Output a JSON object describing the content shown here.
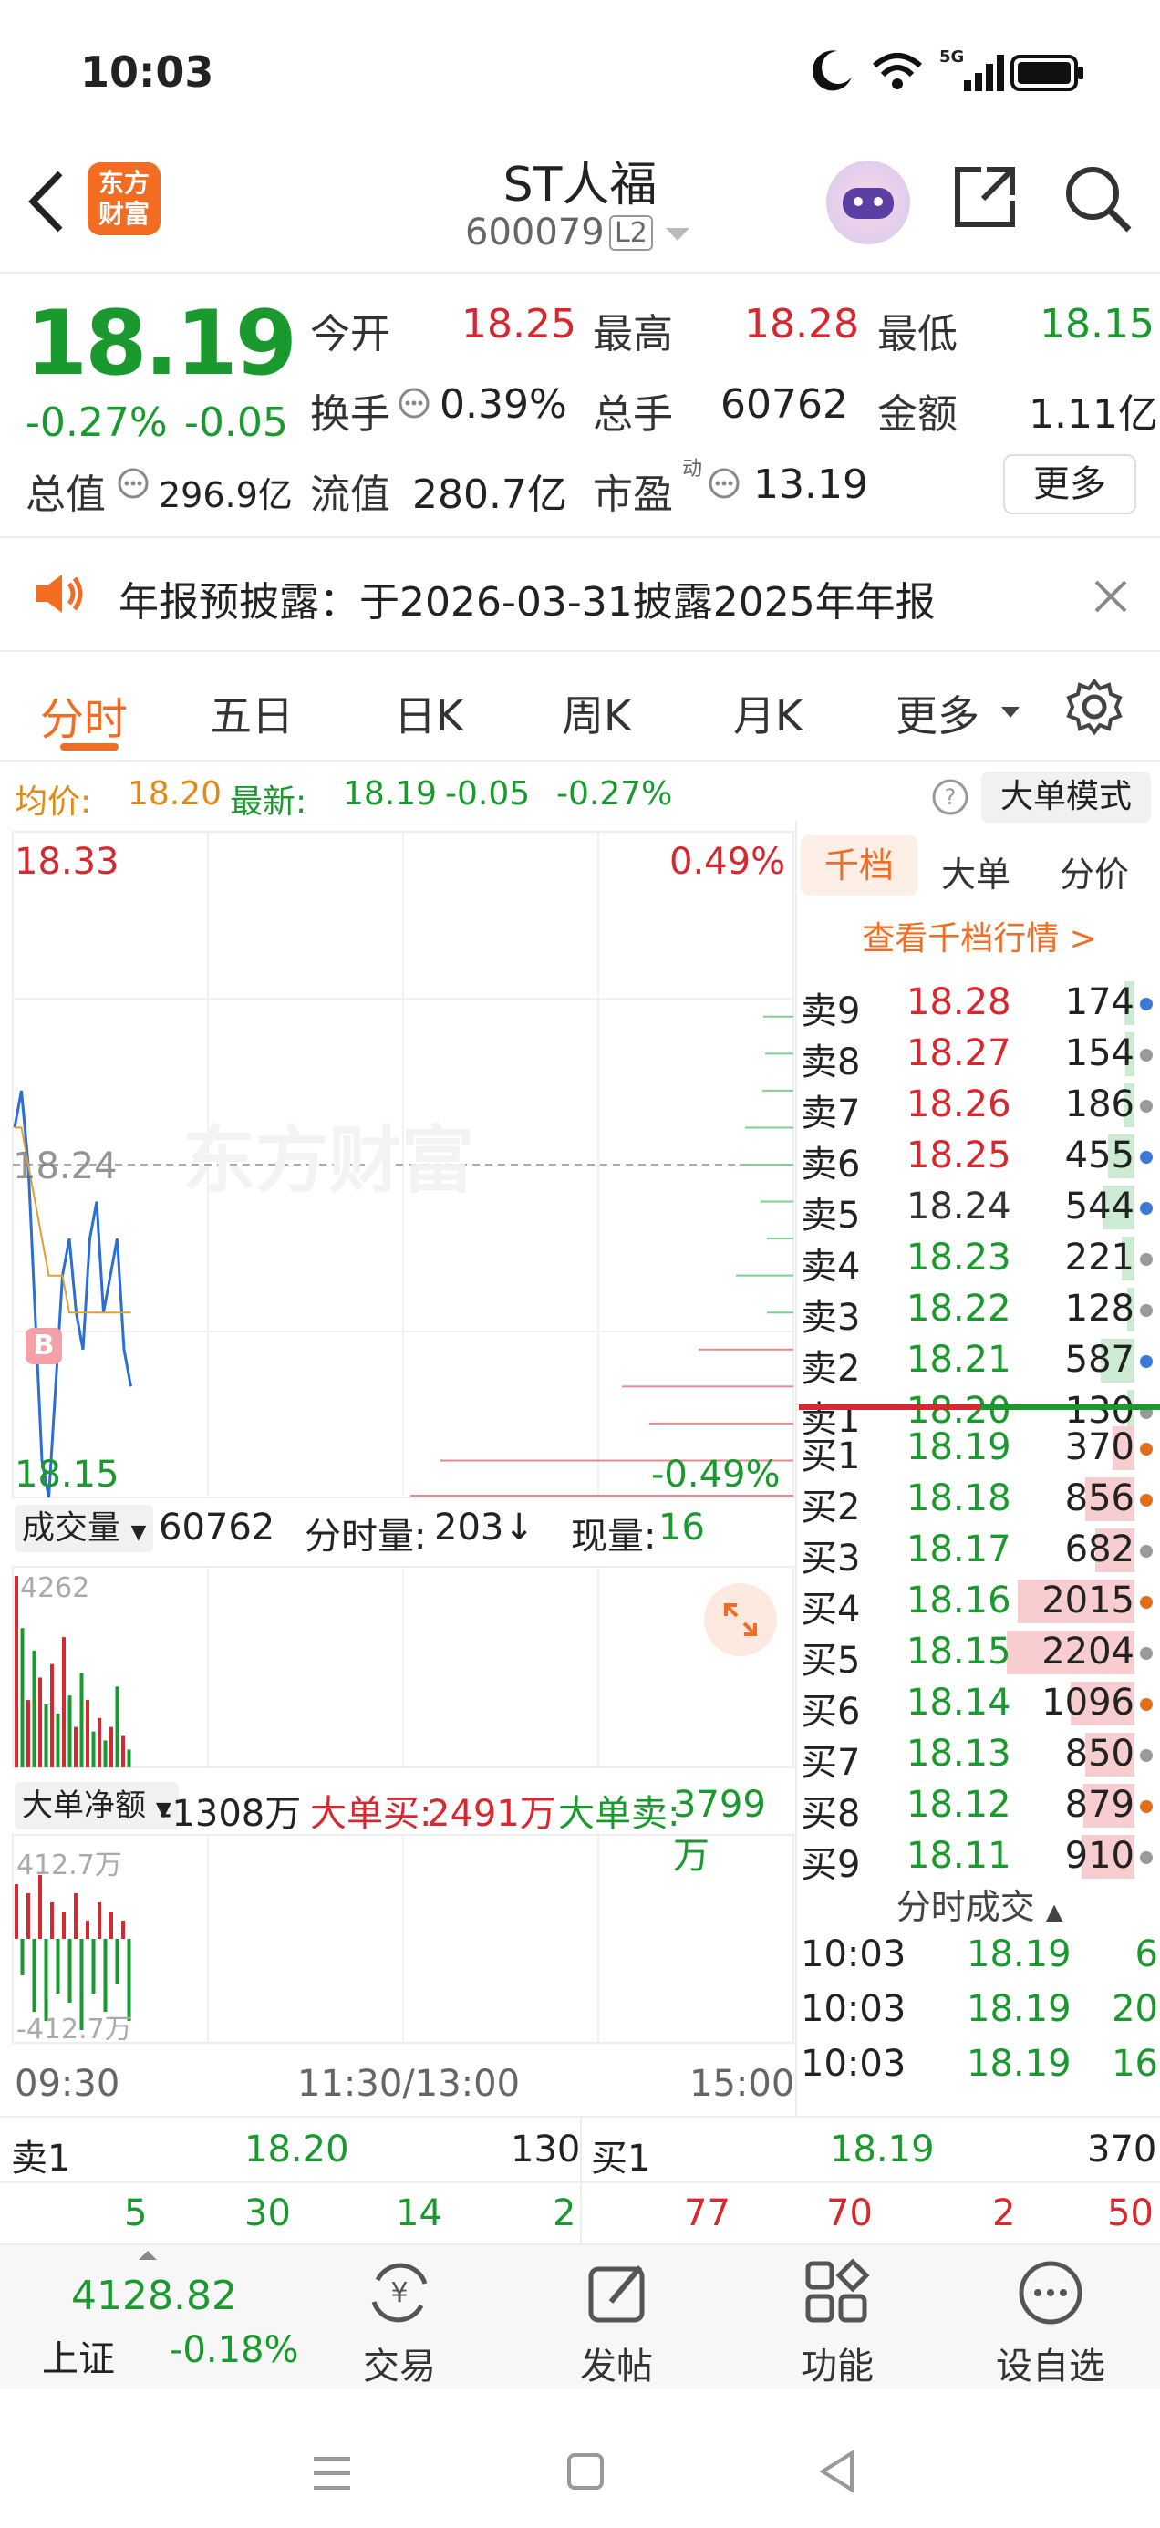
{
  "status": {
    "time": "10:03",
    "network": "5G"
  },
  "header": {
    "title": "ST人福",
    "code": "600079",
    "level": "L2",
    "logo_text": "东方财富"
  },
  "quote": {
    "price": "18.19",
    "pct": "-0.27%",
    "chg": "-0.05",
    "open_label": "今开",
    "open": "18.25",
    "high_label": "最高",
    "high": "18.28",
    "low_label": "最低",
    "low": "18.15",
    "turnover_label": "换手",
    "turnover": "0.39%",
    "volume_label": "总手",
    "volume": "60762",
    "amount_label": "金额",
    "amount": "1.11亿",
    "mktcap_label": "总值",
    "mktcap": "296.9亿",
    "float_label": "流值",
    "float": "280.7亿",
    "pe_label": "市盈",
    "pe_sup": "动",
    "pe": "13.19",
    "more": "更多"
  },
  "notice": {
    "text": "年报预披露：于2026-03-31披露2025年年报"
  },
  "tabs": [
    "分时",
    "五日",
    "日K",
    "周K",
    "月K",
    "更多"
  ],
  "avg": {
    "avg_label": "均价:",
    "avg": "18.20",
    "latest_label": "最新:",
    "latest": "18.19",
    "chg": "-0.05",
    "pct": "-0.27%",
    "mode": "大单模式"
  },
  "chart": {
    "y_top": "18.33",
    "y_mid": "18.24",
    "y_bot": "18.15",
    "pct_top": "0.49%",
    "pct_bot": "-0.49%",
    "watermark": "东方财富",
    "b_marker": "B",
    "vol_label": "成交量",
    "vol": "60762",
    "tick_label": "分时量:",
    "tick": "203↓",
    "now_label": "现量:",
    "now": "16",
    "vol_max": "4262",
    "net_label": "大单净额",
    "net": "-1308万",
    "big_buy_label": "大单买:",
    "big_buy": "2491万",
    "big_sell_label": "大单卖:",
    "big_sell": "3799万",
    "net_max": "412.7万",
    "net_min": "-412.7万",
    "x_start": "09:30",
    "x_mid": "11:30/13:00",
    "x_end": "15:00"
  },
  "chart_data": {
    "type": "line",
    "series": [
      {
        "values": [
          18.25,
          18.26,
          18.24,
          18.2,
          18.16,
          18.15,
          18.18,
          18.21,
          18.22,
          18.2,
          18.19,
          18.22,
          18.23,
          18.2,
          18.21,
          18.22,
          18.19,
          18.18
        ]
      },
      {
        "values": [
          18.25,
          18.25,
          18.24,
          18.23,
          18.22,
          18.21,
          18.21,
          18.21,
          18.2,
          18.2,
          18.2,
          18.2,
          18.2,
          18.2,
          18.2,
          18.2,
          18.2,
          18.2
        ]
      }
    ],
    "volume": [
      4262,
      3100,
      1500,
      2600,
      2000,
      1400,
      2300,
      1200,
      2900,
      1600,
      900,
      2100,
      1500,
      800,
      1100,
      600,
      900,
      1800,
      700,
      400
    ],
    "ylim": [
      18.15,
      18.33
    ]
  },
  "book": {
    "tabs": [
      "千档",
      "大单",
      "分价"
    ],
    "link": "查看千档行情 >",
    "sells": [
      {
        "label": "卖9",
        "price": "18.28",
        "vol": "174",
        "c": "red",
        "dot": "#3a7ad6"
      },
      {
        "label": "卖8",
        "price": "18.27",
        "vol": "154",
        "c": "red",
        "dot": "#999"
      },
      {
        "label": "卖7",
        "price": "18.26",
        "vol": "186",
        "c": "red",
        "dot": "#999"
      },
      {
        "label": "卖6",
        "price": "18.25",
        "vol": "455",
        "c": "red",
        "dot": "#3a7ad6"
      },
      {
        "label": "卖5",
        "price": "18.24",
        "vol": "544",
        "c": "gray",
        "dot": "#3a7ad6"
      },
      {
        "label": "卖4",
        "price": "18.23",
        "vol": "221",
        "c": "green",
        "dot": "#999"
      },
      {
        "label": "卖3",
        "price": "18.22",
        "vol": "128",
        "c": "green",
        "dot": "#999"
      },
      {
        "label": "卖2",
        "price": "18.21",
        "vol": "587",
        "c": "green",
        "dot": "#3a7ad6"
      },
      {
        "label": "卖1",
        "price": "18.20",
        "vol": "130",
        "c": "green",
        "dot": "#999"
      }
    ],
    "buys": [
      {
        "label": "买1",
        "price": "18.19",
        "vol": "370",
        "dot": "#e07020"
      },
      {
        "label": "买2",
        "price": "18.18",
        "vol": "856",
        "dot": "#e07020"
      },
      {
        "label": "买3",
        "price": "18.17",
        "vol": "682",
        "dot": "#999"
      },
      {
        "label": "买4",
        "price": "18.16",
        "vol": "2015",
        "dot": "#e07020"
      },
      {
        "label": "买5",
        "price": "18.15",
        "vol": "2204",
        "dot": "#999"
      },
      {
        "label": "买6",
        "price": "18.14",
        "vol": "1096",
        "dot": "#e07020"
      },
      {
        "label": "买7",
        "price": "18.13",
        "vol": "850",
        "dot": "#999"
      },
      {
        "label": "买8",
        "price": "18.12",
        "vol": "879",
        "dot": "#e07020"
      },
      {
        "label": "买9",
        "price": "18.11",
        "vol": "910",
        "dot": "#999"
      }
    ],
    "trades_title": "分时成交",
    "trades": [
      {
        "t": "10:03",
        "p": "18.19",
        "v": "6"
      },
      {
        "t": "10:03",
        "p": "18.19",
        "v": "20"
      },
      {
        "t": "10:03",
        "p": "18.19",
        "v": "16"
      }
    ]
  },
  "bottom_quote": {
    "sell1_label": "卖1",
    "sell1_price": "18.20",
    "sell1_vol": "130",
    "buy1_label": "买1",
    "buy1_price": "18.19",
    "buy1_vol": "370",
    "sell_orders": [
      "5",
      "30",
      "14",
      "2"
    ],
    "buy_orders": [
      "77",
      "70",
      "2",
      "50"
    ]
  },
  "bottom_bar": {
    "index_value": "4128.82",
    "index_name": "上证",
    "index_pct": "-0.18%",
    "items": [
      "交易",
      "发帖",
      "功能",
      "设自选"
    ]
  }
}
